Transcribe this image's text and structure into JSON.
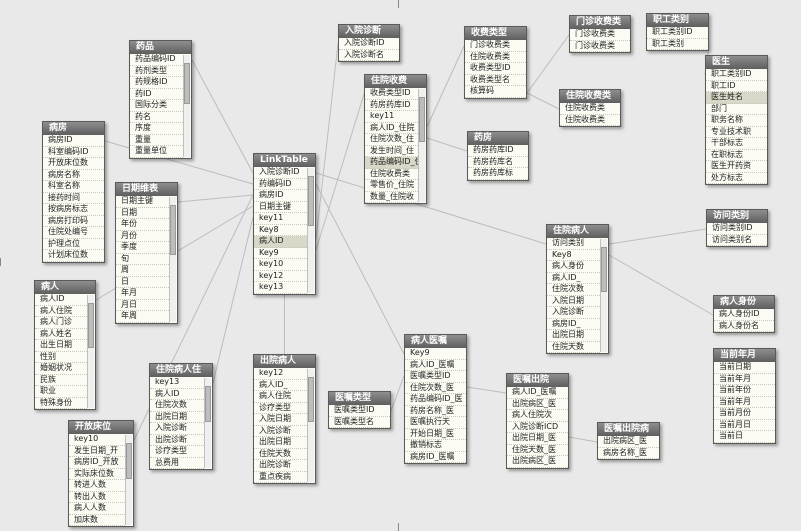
{
  "tables": [
    {
      "name": "药品",
      "fields": [
        "药品编码ID",
        "药剂类型",
        "药规格ID",
        "药ID",
        "国际分类",
        "药名",
        "序度",
        "重量",
        "重量单位"
      ]
    },
    {
      "name": "病房",
      "fields": [
        "病房ID",
        "科室编码ID",
        "开放床位数",
        "病房名称",
        "科室名称",
        "接药时间",
        "按病房标志",
        "病房打印码",
        "住院处编号",
        "护理点位",
        "计划床位数"
      ]
    },
    {
      "name": "日期维表",
      "fields": [
        "日期主键",
        "日期",
        "年份",
        "月份",
        "季度",
        "旬",
        "周",
        "日",
        "年月",
        "月日",
        "年周"
      ]
    },
    {
      "name": "病人",
      "fields": [
        "病人ID",
        "病人住院",
        "病人门诊",
        "病人姓名",
        "出生日期",
        "性别",
        "婚姻状况",
        "民族",
        "职业",
        "特殊身份"
      ]
    },
    {
      "name": "开放床位",
      "fields": [
        "key10",
        "发生日期_开",
        "病房ID_开放",
        "实际床位数",
        "转进人数",
        "转出人数",
        "病人人数",
        "加床数"
      ]
    },
    {
      "name": "住院病人住",
      "fields": [
        "key13",
        "病人ID",
        "住院次数",
        "出院日期",
        "入院诊断",
        "出院诊断",
        "诊疗类型",
        "总费用"
      ]
    },
    {
      "name": "LinkTable",
      "fields": [
        "入院诊断ID",
        "药编码ID",
        "病房ID",
        "日期主键",
        "key11",
        "Key8",
        "病人ID",
        "Key9",
        "key10",
        "key12",
        "key13"
      ]
    },
    {
      "name": "出院病人",
      "fields": [
        "key12",
        "病人ID_",
        "病人住院",
        "诊疗类型",
        "入院日期",
        "入院诊断",
        "出院日期",
        "住院天数",
        "出院诊断",
        "重点疾病"
      ]
    },
    {
      "name": "入院诊断",
      "fields": [
        "入院诊断ID",
        "入院诊断名"
      ]
    },
    {
      "name": "住院收费",
      "fields": [
        "收费类型ID",
        "药房药库ID",
        "key11",
        "病人ID_住院",
        "住院次数_住",
        "发生时间_住",
        "药品编码ID_住",
        "住院收费类",
        "零售价_住院",
        "数量_住院收"
      ]
    },
    {
      "name": "收费类型",
      "fields": [
        "门诊收费类",
        "住院收费类",
        "收费类型ID",
        "收费类型名",
        "核算码"
      ]
    },
    {
      "name": "门诊收费类",
      "fields": [
        "门诊收费类",
        "门诊收费类"
      ]
    },
    {
      "name": "住院收费类",
      "fields": [
        "住院收费类",
        "住院收费类"
      ]
    },
    {
      "name": "药房",
      "fields": [
        "药房药库ID",
        "药房药库名",
        "药房药库标"
      ]
    },
    {
      "name": "职工类别",
      "fields": [
        "职工类别ID",
        "职工类别"
      ]
    },
    {
      "name": "医生",
      "fields": [
        "职工类别ID",
        "职工ID",
        "医生姓名",
        "部门",
        "职务名称",
        "专业技术职",
        "干部标志",
        "在职标志",
        "医生开药资",
        "处方标志"
      ]
    },
    {
      "name": "访问类别",
      "fields": [
        "访问类别ID",
        "访问类别名"
      ]
    },
    {
      "name": "住院病人",
      "fields": [
        "访问类别",
        "Key8",
        "病人身份",
        "病人ID_",
        "住院次数",
        "入院日期",
        "入院诊断",
        "病房ID_",
        "出院日期",
        "住院天数"
      ]
    },
    {
      "name": "病人身份",
      "fields": [
        "病人身份ID",
        "病人身份名"
      ]
    },
    {
      "name": "当前年月",
      "fields": [
        "当前日期",
        "当前年月",
        "当前年份",
        "当前年月",
        "当前月份",
        "当前月日",
        "当前日"
      ]
    },
    {
      "name": "医嘱类型",
      "fields": [
        "医嘱类型ID",
        "医嘱类型名"
      ]
    },
    {
      "name": "病人医嘱",
      "fields": [
        "Key9",
        "病人ID_医嘱",
        "医嘱类型ID",
        "住院次数_医",
        "药品编码ID_医",
        "药房名称_医",
        "医嘱执行天",
        "开始日期_医",
        "撤销标志",
        "病房ID_医嘱"
      ]
    },
    {
      "name": "医嘱出院",
      "fields": [
        "病人ID_医嘱",
        "出院病区_医",
        "病人住院次",
        "入院诊断ICD",
        "出院日期_医",
        "住院天数_医",
        "出院病区_医"
      ]
    },
    {
      "name": "医嘱出院病",
      "fields": [
        "出院病区_医",
        "病房名称_医"
      ]
    }
  ],
  "colors": {
    "canvas": "#e9e9e9",
    "header_top": "#8e8e8e",
    "header_bottom": "#5e5e5e",
    "body": "#fbfbf3",
    "link": "#bdbdbd"
  }
}
